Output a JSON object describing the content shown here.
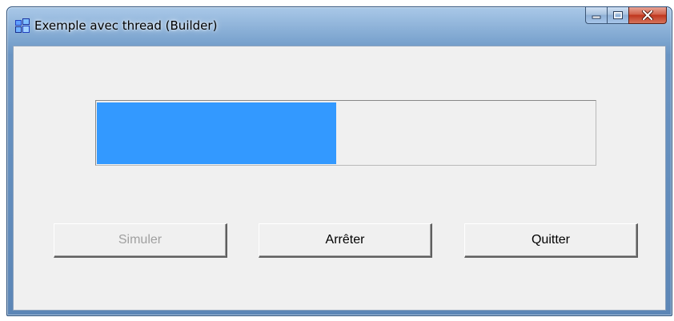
{
  "window": {
    "title": "Exemple avec thread (Builder)",
    "icon": "app-icon",
    "caption_buttons": [
      "minimize-icon",
      "maximize-icon",
      "close-icon"
    ]
  },
  "progress": {
    "fraction": 0.48,
    "fill_color": "#3399ff"
  },
  "buttons": {
    "simuler": {
      "label": "Simuler",
      "enabled": false
    },
    "arreter": {
      "label": "Arrêter",
      "enabled": true
    },
    "quitter": {
      "label": "Quitter",
      "enabled": true
    }
  }
}
